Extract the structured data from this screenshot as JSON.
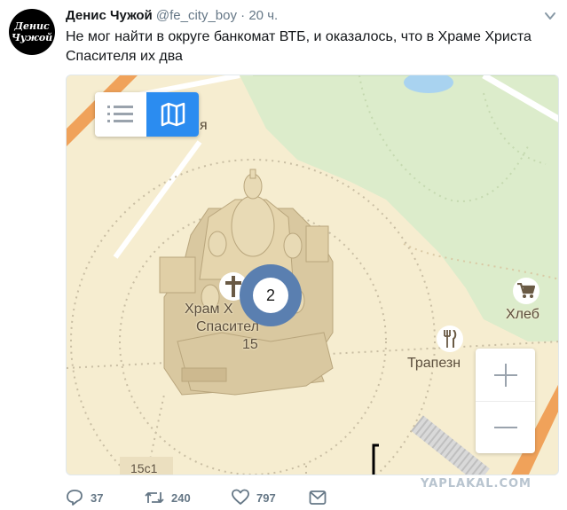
{
  "author": {
    "avatar_line1": "Денис",
    "avatar_line2": "Чужой",
    "name": "Денис Чужой",
    "handle": "@fe_city_boy",
    "separator": "·",
    "time": "20 ч."
  },
  "tweet": {
    "text": "Не мог найти в округе банкомат ВТБ, и оказалось, что в Храме Христа Спасителя их два"
  },
  "map": {
    "cluster_count": "2",
    "labels": {
      "cathedral_name_1": "Храм Х",
      "cathedral_name_2": "Спасител",
      "cathedral_number": "15",
      "top_fragment": "я",
      "shop": "Хлеб",
      "restaurant": "Трапезн",
      "building": "15с1"
    },
    "icons": {
      "list_view": "list-icon",
      "map_view": "map-icon",
      "zoom_in": "plus-icon",
      "zoom_out": "minus-icon",
      "shop": "cart-icon",
      "restaurant": "fork-knife-icon",
      "church": "cross-icon"
    },
    "colors": {
      "background": "#f6edd0",
      "park": "#dceccb",
      "active_toggle": "#2b8cf0",
      "cluster_ring": "#5a7fb0"
    }
  },
  "actions": {
    "reply_count": "37",
    "retweet_count": "240",
    "like_count": "797"
  },
  "watermark": "YAPLAKAL.COM"
}
